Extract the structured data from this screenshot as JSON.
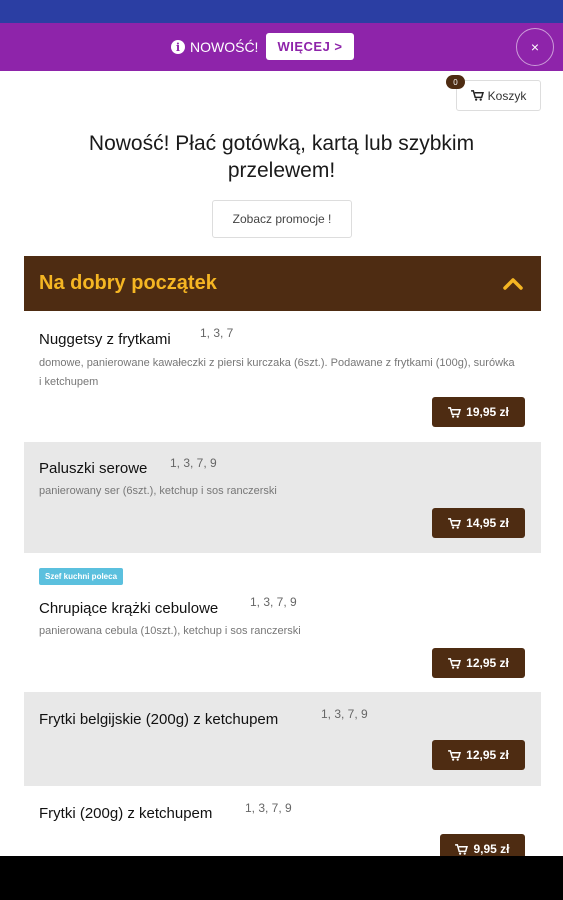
{
  "colors": {
    "status_bar": "#2b3ea3",
    "promo_bar": "#8e24aa",
    "brand_brown": "#4e2c12",
    "category_title": "#f5b623",
    "badge": "#5bc0de"
  },
  "promo": {
    "text": "NOWOŚĆ!",
    "button_label": "WIĘCEJ >",
    "close_label": "×",
    "icon": "info-icon"
  },
  "cart": {
    "count": "0",
    "label": "Koszyk",
    "icon": "cart-icon"
  },
  "headline": "Nowość! Płać gotówką, kartą lub szybkim przelewem!",
  "promo_link": "Zobacz promocje !",
  "category": {
    "title": "Na dobry początek",
    "icon": "chevron-up-icon"
  },
  "items": [
    {
      "name": "Nuggetsy z frytkami",
      "allergens": "1, 3, 7",
      "description": "domowe, panierowane kawałeczki z piersi kurczaka (6szt.). Podawane z frytkami (100g), surówka i ketchupem",
      "price": "19,95 zł"
    },
    {
      "name": "Paluszki serowe",
      "allergens": "1, 3, 7, 9",
      "description": "panierowany ser (6szt.), ketchup i sos ranczerski",
      "price": "14,95 zł"
    },
    {
      "badge": "Szef kuchni poleca",
      "name": "Chrupiące krążki cebulowe",
      "allergens": "1, 3, 7, 9",
      "description": "panierowana cebula (10szt.), ketchup i sos ranczerski",
      "price": "12,95 zł"
    },
    {
      "name": "Frytki belgijskie (200g) z ketchupem",
      "allergens": "1, 3, 7, 9",
      "description": "",
      "price": "12,95 zł"
    },
    {
      "name": "Frytki (200g) z ketchupem",
      "allergens": "1, 3, 7, 9",
      "description": "",
      "price": "9,95 zł"
    }
  ]
}
